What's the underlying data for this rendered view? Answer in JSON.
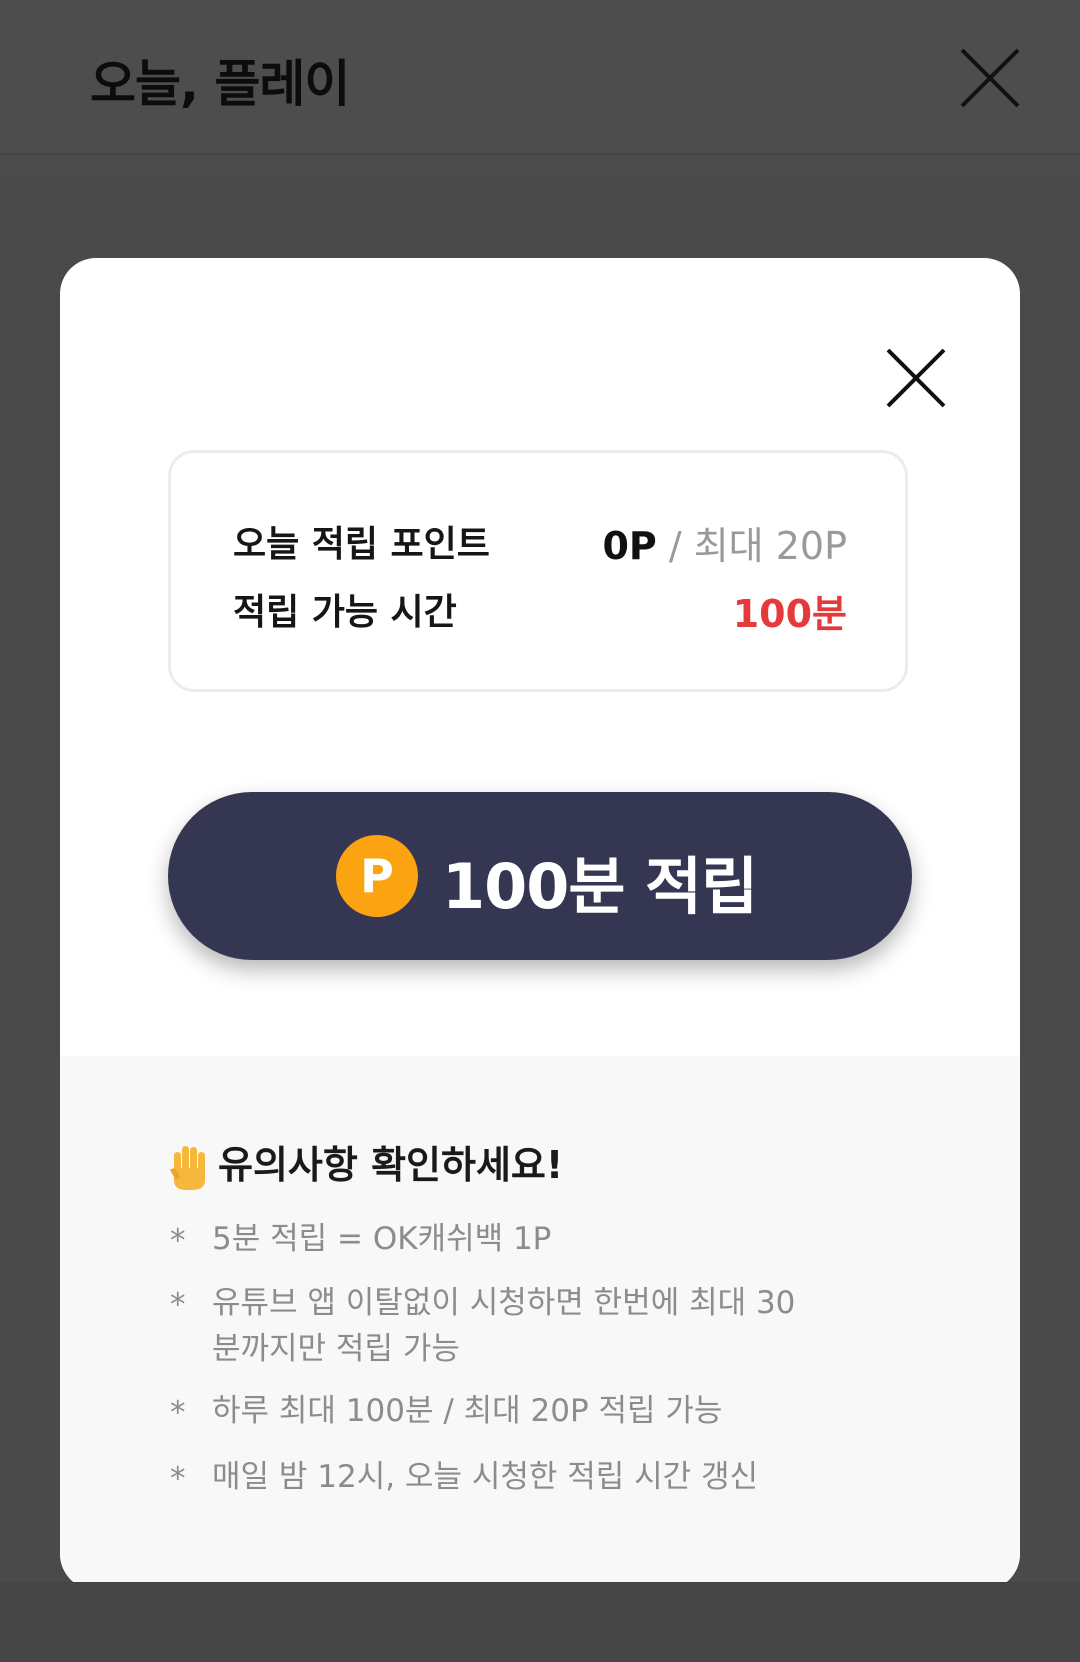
{
  "header": {
    "title": "오늘, 플레이",
    "close_icon": "close-icon"
  },
  "modal": {
    "close_icon": "close-icon",
    "stats": {
      "today_points_label": "오늘 적립 포인트",
      "today_points_value": "0P",
      "today_points_max": " / 최대 20P",
      "available_time_label": "적립 가능 시간",
      "available_time_value": "100분"
    },
    "earn_button": {
      "badge": "P",
      "label": "100분 적립",
      "color": "#353652",
      "badge_color": "#fca311"
    },
    "notice": {
      "icon": "raised-hand-icon",
      "title": "유의사항 확인하세요!",
      "bullet": "*",
      "items": [
        "5분 적립 = OK캐쉬백 1P",
        "유튜브 앱 이탈없이 시청하면 한번에 최대 30분까지만 적립 가능",
        "하루 최대 100분 / 최대 20P 적립 가능",
        "매일 밤 12시, 오늘 시청한 적립 시간 갱신"
      ]
    }
  },
  "colors": {
    "accent_red": "#e5393b",
    "overlay": "#4a4a4a"
  }
}
